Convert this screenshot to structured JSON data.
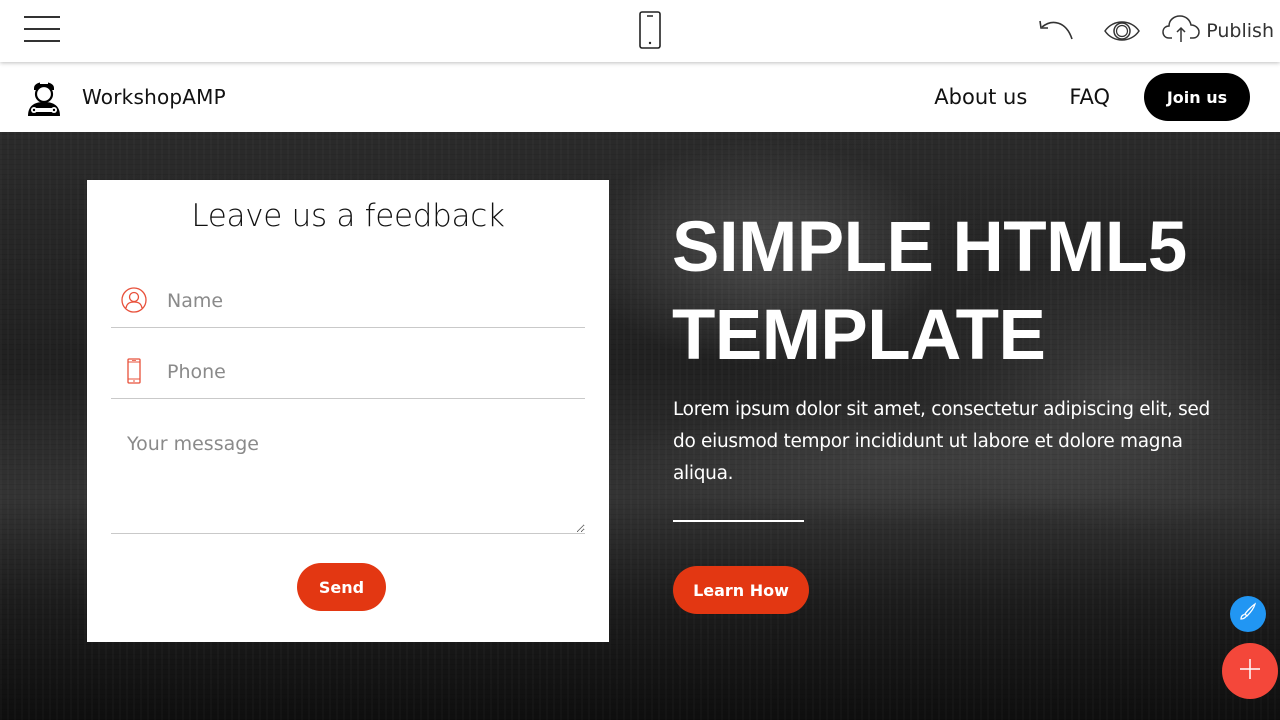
{
  "editor_toolbar": {
    "menu_icon": "hamburger-icon",
    "device_icon": "mobile-phone-icon",
    "undo_icon": "undo-icon",
    "preview_icon": "eye-icon",
    "publish_icon": "cloud-upload-icon",
    "publish_label": "Publish"
  },
  "navbar": {
    "brand_icon": "mechanic-icon",
    "brand_name": "WorkshopAMP",
    "links": [
      {
        "label": "About us"
      },
      {
        "label": "FAQ"
      }
    ],
    "cta_label": "Join us"
  },
  "form": {
    "title": "Leave us a feedback",
    "name": {
      "icon": "user-icon",
      "placeholder": "Name",
      "value": ""
    },
    "phone": {
      "icon": "phone-icon",
      "placeholder": "Phone",
      "value": ""
    },
    "message": {
      "placeholder": "Your message",
      "value": ""
    },
    "submit_label": "Send"
  },
  "hero": {
    "title_line1": "SIMPLE HTML5",
    "title_line2": "TEMPLATE",
    "text": "Lorem ipsum dolor sit amet, consectetur adipiscing elit, sed do eiusmod tempor incididunt ut labore et dolore magna aliqua.",
    "cta_label": "Learn How"
  },
  "floating": {
    "style_icon": "paintbrush-icon",
    "add_icon": "plus-icon"
  },
  "colors": {
    "accent": "#e33712",
    "fab_blue": "#2196f3",
    "fab_red": "#f4473a",
    "cta_dark": "#000000"
  }
}
